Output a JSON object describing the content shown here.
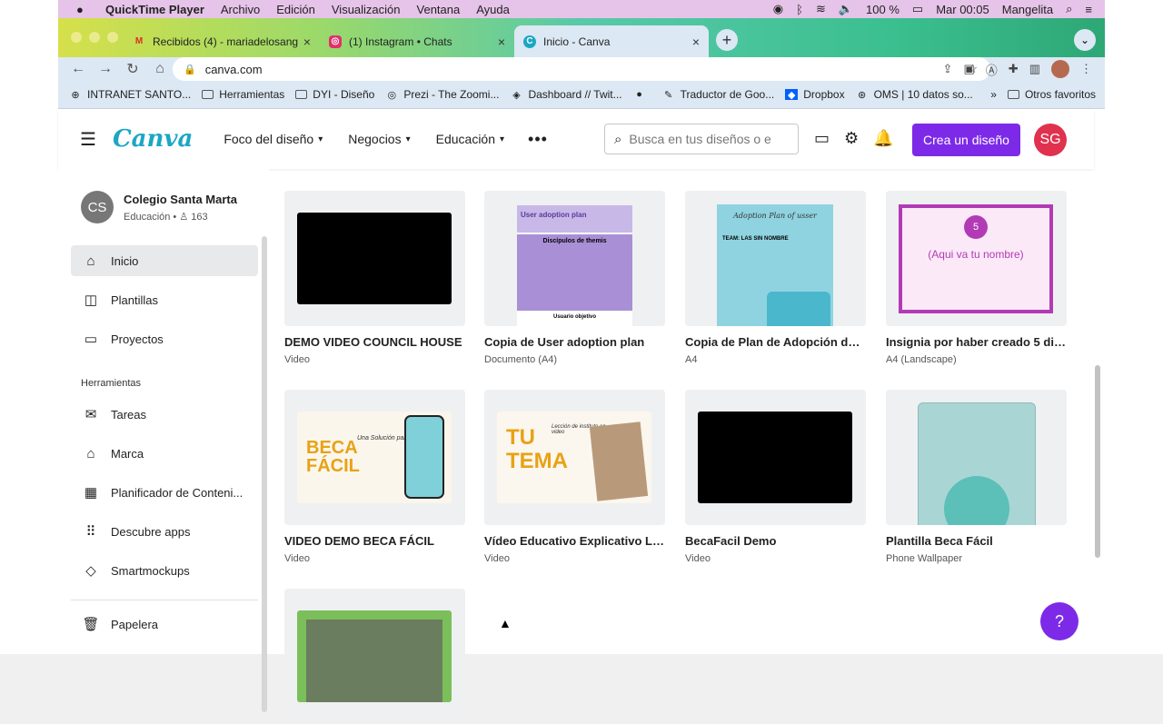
{
  "menubar": {
    "app": "QuickTime Player",
    "items": [
      "Archivo",
      "Edición",
      "Visualización",
      "Ventana",
      "Ayuda"
    ],
    "battery": "100 %",
    "time": "Mar 00:05",
    "user": "Mangelita"
  },
  "tabs": [
    {
      "label": "Recibidos (4) - mariadelosang",
      "icon": "gmail-icon"
    },
    {
      "label": "(1) Instagram • Chats",
      "icon": "instagram-icon"
    },
    {
      "label": "Inicio - Canva",
      "icon": "canva-icon"
    }
  ],
  "url": "canva.com",
  "bookmarks": [
    {
      "label": "INTRANET SANTO..."
    },
    {
      "label": "Herramientas"
    },
    {
      "label": "DYI - Diseño"
    },
    {
      "label": "Prezi - The Zoomi..."
    },
    {
      "label": "Dashboard // Twit..."
    },
    {
      "label": ""
    },
    {
      "label": "Traductor de Goo..."
    },
    {
      "label": "Dropbox"
    },
    {
      "label": "OMS | 10 datos so..."
    }
  ],
  "bookmarks_other": "Otros favoritos",
  "header": {
    "logo": "Canva",
    "nav": [
      "Foco del diseño",
      "Negocios",
      "Educación"
    ],
    "search_placeholder": "Busca en tus diseños o e",
    "create_label": "Crea un diseño",
    "avatar": "SG"
  },
  "team": {
    "initials": "CS",
    "name": "Colegio Santa Marta",
    "sub": "Educación • ♙ 163"
  },
  "sidebar": {
    "items": [
      "Inicio",
      "Plantillas",
      "Proyectos"
    ],
    "tools_title": "Herramientas",
    "tools": [
      "Tareas",
      "Marca",
      "Planificador de Conteni...",
      "Descubre apps",
      "Smartmockups"
    ],
    "trash": "Papelera"
  },
  "designs": [
    {
      "title": "DEMO VIDEO COUNCIL HOUSE",
      "type": "Video"
    },
    {
      "title": "Copia de User adoption plan",
      "type": "Documento (A4)"
    },
    {
      "title": "Copia de Plan de Adopción de ...",
      "type": "A4"
    },
    {
      "title": "Insignia por haber creado 5 dis...",
      "type": "A4 (Landscape)"
    },
    {
      "title": "VIDEO DEMO BECA FÁCIL",
      "type": "Video"
    },
    {
      "title": "Vídeo Educativo Explicativo Lí...",
      "type": "Video"
    },
    {
      "title": "BecaFacil Demo",
      "type": "Video"
    },
    {
      "title": "Plantilla Beca Fácil",
      "type": "Phone Wallpaper"
    }
  ],
  "thumbs": {
    "adoption_header": "User adoption plan",
    "adoption_sub": "Discípulos de themis",
    "adoption_foot": "Usuario objetivo",
    "plan_title": "Adoption Plan of usser",
    "plan_team": "TEAM: LAS SIN NOMBRE",
    "badge_num": "5",
    "badge_text": "(Aqui va tu nombre)",
    "beca": "BECA FÁCIL",
    "beca_sub": "Una Solución para ti",
    "tu_tema": "TU TEMA",
    "tema_sub": "Lección de instituto en video"
  },
  "help": "?"
}
